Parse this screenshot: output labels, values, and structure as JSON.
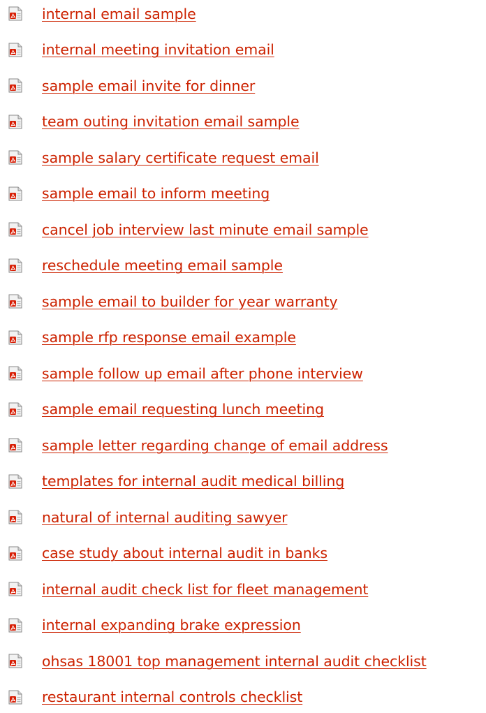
{
  "links": {
    "icon": "pdf-file-icon",
    "link_color": "#cc2200",
    "items": [
      {
        "label": "internal email sample"
      },
      {
        "label": "internal meeting invitation email"
      },
      {
        "label": "sample email invite for dinner"
      },
      {
        "label": "team outing invitation email sample"
      },
      {
        "label": "sample salary certificate request email"
      },
      {
        "label": "sample email to inform meeting"
      },
      {
        "label": "cancel job interview last minute email sample"
      },
      {
        "label": "reschedule meeting email sample"
      },
      {
        "label": "sample email to builder for year warranty"
      },
      {
        "label": "sample rfp response email example"
      },
      {
        "label": "sample follow up email after phone interview"
      },
      {
        "label": "sample email requesting lunch meeting"
      },
      {
        "label": "sample letter regarding change of email address"
      },
      {
        "label": "templates for internal audit medical billing"
      },
      {
        "label": "natural of internal auditing sawyer"
      },
      {
        "label": "case study about internal audit in banks"
      },
      {
        "label": "internal audit check list for fleet management"
      },
      {
        "label": "internal expanding brake expression"
      },
      {
        "label": "ohsas 18001 top management internal audit checklist"
      },
      {
        "label": "restaurant internal controls checklist"
      }
    ]
  }
}
